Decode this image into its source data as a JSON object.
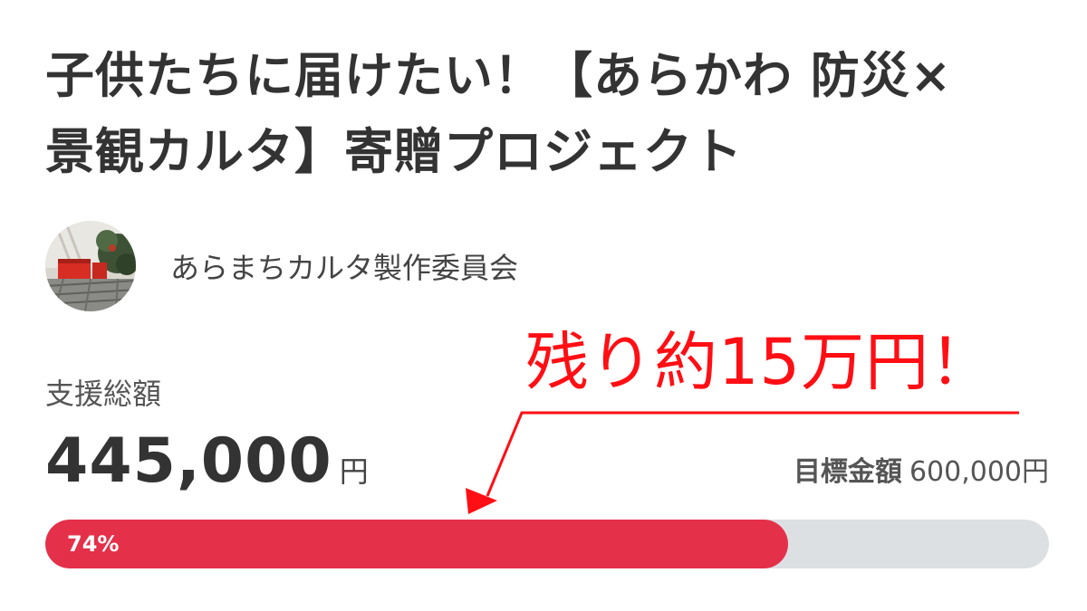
{
  "project": {
    "title_line1": "子供たちに届けたい！【あらかわ 防災×",
    "title_line2": "景観カルタ】寄贈プロジェクト"
  },
  "author": {
    "name": "あらまちカルタ製作委員会",
    "avatar_icon": "avatar-photo-icon"
  },
  "annotation": {
    "text": "残り約15万円！",
    "color": "#ff0f14"
  },
  "funding": {
    "total_label": "支援総額",
    "total_amount": "445,000",
    "total_unit": "円",
    "goal_label": "目標金額",
    "goal_value": "600,000円",
    "percent_label": "74%",
    "percent_value": 74
  },
  "colors": {
    "progress_fill": "#e5304a",
    "progress_track": "#dde0e3",
    "text": "#333333"
  }
}
